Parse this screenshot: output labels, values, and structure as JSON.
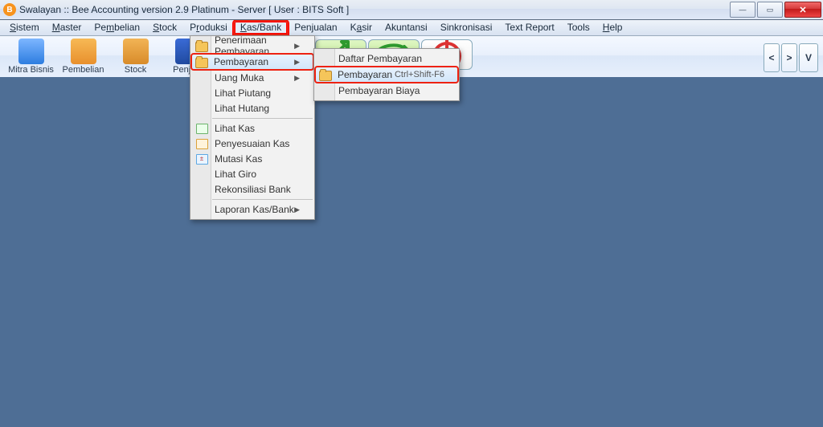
{
  "window": {
    "title": "Swalayan :: Bee Accounting version 2.9 Platinum - Server   [ User : BITS Soft ]"
  },
  "menubar": [
    {
      "label": "Sistem",
      "u": 0
    },
    {
      "label": "Master",
      "u": 0
    },
    {
      "label": "Pembelian",
      "u": 2
    },
    {
      "label": "Stock",
      "u": 0
    },
    {
      "label": "Produksi",
      "u": 1
    },
    {
      "label": "Kas/Bank",
      "u": 0,
      "active": true
    },
    {
      "label": "Penjualan",
      "u": 3
    },
    {
      "label": "Kasir",
      "u": 1
    },
    {
      "label": "Akuntansi",
      "u": -1
    },
    {
      "label": "Sinkronisasi",
      "u": -1
    },
    {
      "label": "Text Report",
      "u": -1
    },
    {
      "label": "Tools",
      "u": -1
    },
    {
      "label": "Help",
      "u": 0
    }
  ],
  "toolbar": [
    {
      "label": "Mitra Bisnis",
      "icon": "books"
    },
    {
      "label": "Pembelian",
      "icon": "shelf"
    },
    {
      "label": "Stock",
      "icon": "box"
    },
    {
      "label": "Penjual",
      "icon": "bag"
    }
  ],
  "nav_right": {
    "prev": "<",
    "next": ">",
    "v": "V"
  },
  "dropdown": {
    "main": [
      {
        "label": "Penerimaan Pembayaran",
        "arrow": true,
        "icon": "folder"
      },
      {
        "label": "Pembayaran",
        "arrow": true,
        "icon": "folder",
        "highlight": true
      },
      {
        "label": "Uang Muka",
        "arrow": true
      },
      {
        "label": "Lihat Piutang"
      },
      {
        "label": "Lihat Hutang"
      },
      {
        "sep": true
      },
      {
        "label": "Lihat Kas",
        "icon": "list"
      },
      {
        "label": "Penyesuaian Kas",
        "icon": "adjust"
      },
      {
        "label": "Mutasi Kas",
        "icon": "mutasi"
      },
      {
        "label": "Lihat Giro"
      },
      {
        "label": "Rekonsiliasi Bank"
      },
      {
        "sep": true
      },
      {
        "label": "Laporan Kas/Bank",
        "arrow": true
      }
    ],
    "sub": [
      {
        "label": "Daftar Pembayaran"
      },
      {
        "label": "Pembayaran",
        "kbd": "Ctrl+Shift-F6",
        "icon": "folder",
        "highlight": true
      },
      {
        "label": "Pembayaran Biaya"
      }
    ]
  }
}
